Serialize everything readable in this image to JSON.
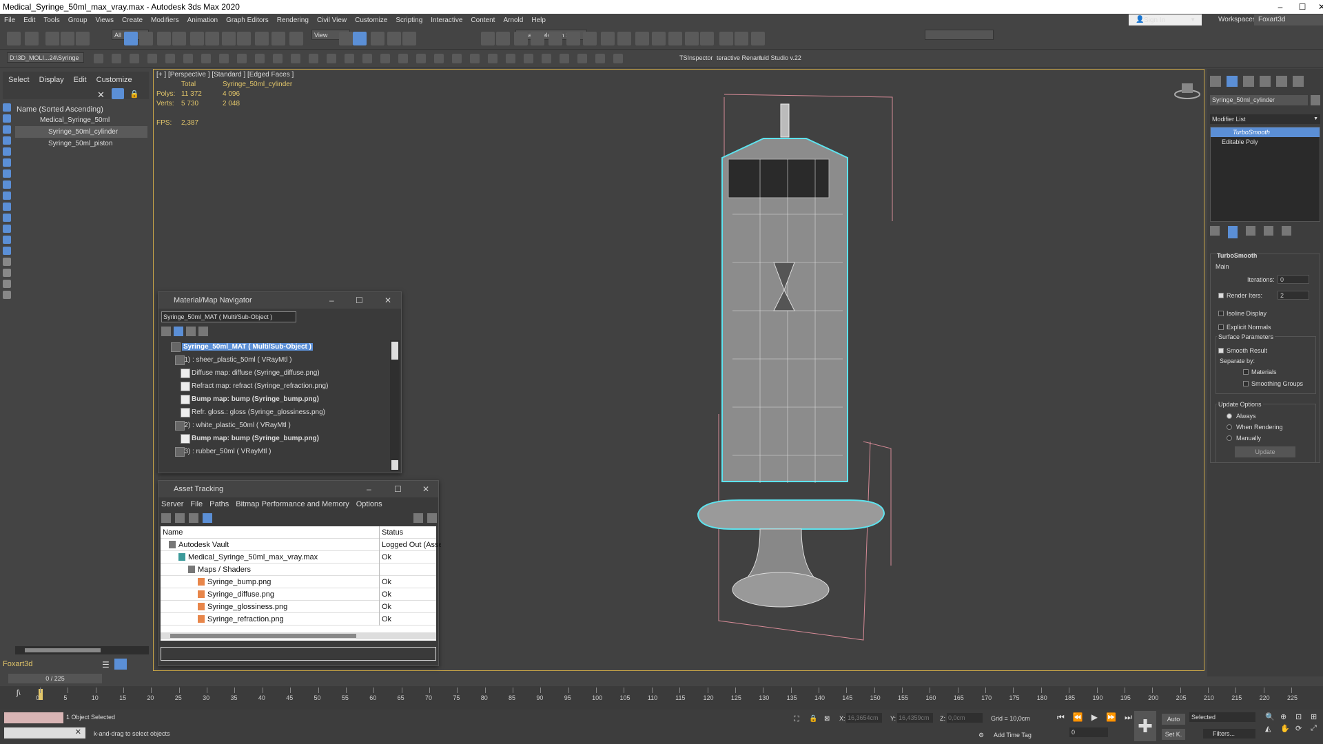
{
  "window": {
    "title": "Medical_Syringe_50ml_max_vray.max - Autodesk 3ds Max 2020",
    "min": "–",
    "max": "☐",
    "close": "✕"
  },
  "menu": [
    "File",
    "Edit",
    "Tools",
    "Group",
    "Views",
    "Create",
    "Modifiers",
    "Animation",
    "Graph Editors",
    "Rendering",
    "Civil View",
    "Customize",
    "Scripting",
    "Interactive",
    "Content",
    "Arnold",
    "Help"
  ],
  "signin": "Sign In",
  "workspaces_label": "Workspaces:",
  "workspace": "Foxart3d",
  "toolbar": {
    "filter": "All",
    "view": "View",
    "selection_set": "Create Selection Set",
    "path": "D:\\3D_MOLI...24\\Syringe",
    "ts_inspector": "TSInspector",
    "interactive_rename": "teractive Renam",
    "fluid_studio": "luid Studio v.22"
  },
  "scene_explorer": {
    "tabs": [
      "Select",
      "Display",
      "Edit",
      "Customize"
    ],
    "header": "Name (Sorted Ascending)",
    "items": [
      "Medical_Syringe_50ml",
      "Syringe_50ml_cylinder",
      "Syringe_50ml_piston"
    ]
  },
  "viewport": {
    "labels": "[+ ] [Perspective ] [Standard ] [Edged Faces ]",
    "stats": {
      "total": "Total",
      "object": "Syringe_50ml_cylinder",
      "polys_label": "Polys:",
      "polys_total": "11 372",
      "polys_obj": "4 096",
      "verts_label": "Verts:",
      "verts_total": "5 730",
      "verts_obj": "2 048",
      "fps_label": "FPS:",
      "fps": "2,387"
    }
  },
  "mat_nav": {
    "title": "Material/Map Navigator",
    "field": "Syringe_50ml_MAT ( Multi/Sub-Object )",
    "rows": [
      {
        "t": "Syringe_50ml_MAT ( Multi/Sub-Object )",
        "lvl": 0,
        "sel": true
      },
      {
        "t": "(1) : sheer_plastic_50ml ( VRayMtl )",
        "lvl": 1
      },
      {
        "t": "Diffuse map: diffuse (Syringe_diffuse.png)",
        "lvl": 2
      },
      {
        "t": "Refract map: refract (Syringe_refraction.png)",
        "lvl": 2
      },
      {
        "t": "Bump map: bump (Syringe_bump.png)",
        "lvl": 2,
        "bold": true
      },
      {
        "t": "Refr. gloss.: gloss (Syringe_glossiness.png)",
        "lvl": 2
      },
      {
        "t": "(2) : white_plastic_50ml ( VRayMtl )",
        "lvl": 1
      },
      {
        "t": "Bump map: bump (Syringe_bump.png)",
        "lvl": 2,
        "bold": true
      },
      {
        "t": "(3) : rubber_50ml ( VRayMtl )",
        "lvl": 1
      }
    ]
  },
  "asset": {
    "title": "Asset Tracking",
    "menu": [
      "Server",
      "File",
      "Paths",
      "Bitmap Performance and Memory",
      "Options"
    ],
    "col_name": "Name",
    "col_status": "Status",
    "rows": [
      {
        "n": "Autodesk Vault",
        "s": "Logged Out (Asse",
        "lvl": 0
      },
      {
        "n": "Medical_Syringe_50ml_max_vray.max",
        "s": "Ok",
        "lvl": 1
      },
      {
        "n": "Maps / Shaders",
        "s": "",
        "lvl": 2
      },
      {
        "n": "Syringe_bump.png",
        "s": "Ok",
        "lvl": 3
      },
      {
        "n": "Syringe_diffuse.png",
        "s": "Ok",
        "lvl": 3
      },
      {
        "n": "Syringe_glossiness.png",
        "s": "Ok",
        "lvl": 3
      },
      {
        "n": "Syringe_refraction.png",
        "s": "Ok",
        "lvl": 3
      }
    ]
  },
  "cmd": {
    "object_name": "Syringe_50ml_cylinder",
    "modifier_list": "Modifier List",
    "stack": [
      "TurboSmooth",
      "Editable Poly"
    ],
    "rollout": "TurboSmooth",
    "main": "Main",
    "iterations_label": "Iterations:",
    "iterations": "0",
    "render_iters_label": "Render Iters:",
    "render_iters": "2",
    "isoline": "Isoline Display",
    "explicit": "Explicit Normals",
    "surface": "Surface Parameters",
    "smooth_result": "Smooth Result",
    "separate": "Separate by:",
    "materials": "Materials",
    "smoothing": "Smoothing Groups",
    "update_options": "Update Options",
    "always": "Always",
    "when_rendering": "When Rendering",
    "manually": "Manually",
    "update": "Update"
  },
  "left_bottom": {
    "user": "Foxart3d",
    "frame": "0 / 225"
  },
  "timeline": {
    "ticks": [
      "0",
      "5",
      "10",
      "15",
      "20",
      "25",
      "30",
      "35",
      "40",
      "45",
      "50",
      "55",
      "60",
      "65",
      "70",
      "75",
      "80",
      "85",
      "90",
      "95",
      "100",
      "105",
      "110",
      "115",
      "120",
      "125",
      "130",
      "135",
      "140",
      "145",
      "150",
      "155",
      "160",
      "165",
      "170",
      "175",
      "180",
      "185",
      "190",
      "195",
      "200",
      "205",
      "210",
      "215",
      "220",
      "225"
    ]
  },
  "status": {
    "selected": "1 Object Selected",
    "hint": "k-and-drag to select objects",
    "x_label": "X:",
    "x": "16,3654cm",
    "y_label": "Y:",
    "y": "16,4359cm",
    "z_label": "Z:",
    "z": "0,0cm",
    "grid": "Grid = 10,0cm",
    "add_time_tag": "Add Time Tag",
    "auto": "Auto",
    "setk": "Set K.",
    "selected_dd": "Selected",
    "filters": "Filters...",
    "frame_field": "0"
  }
}
